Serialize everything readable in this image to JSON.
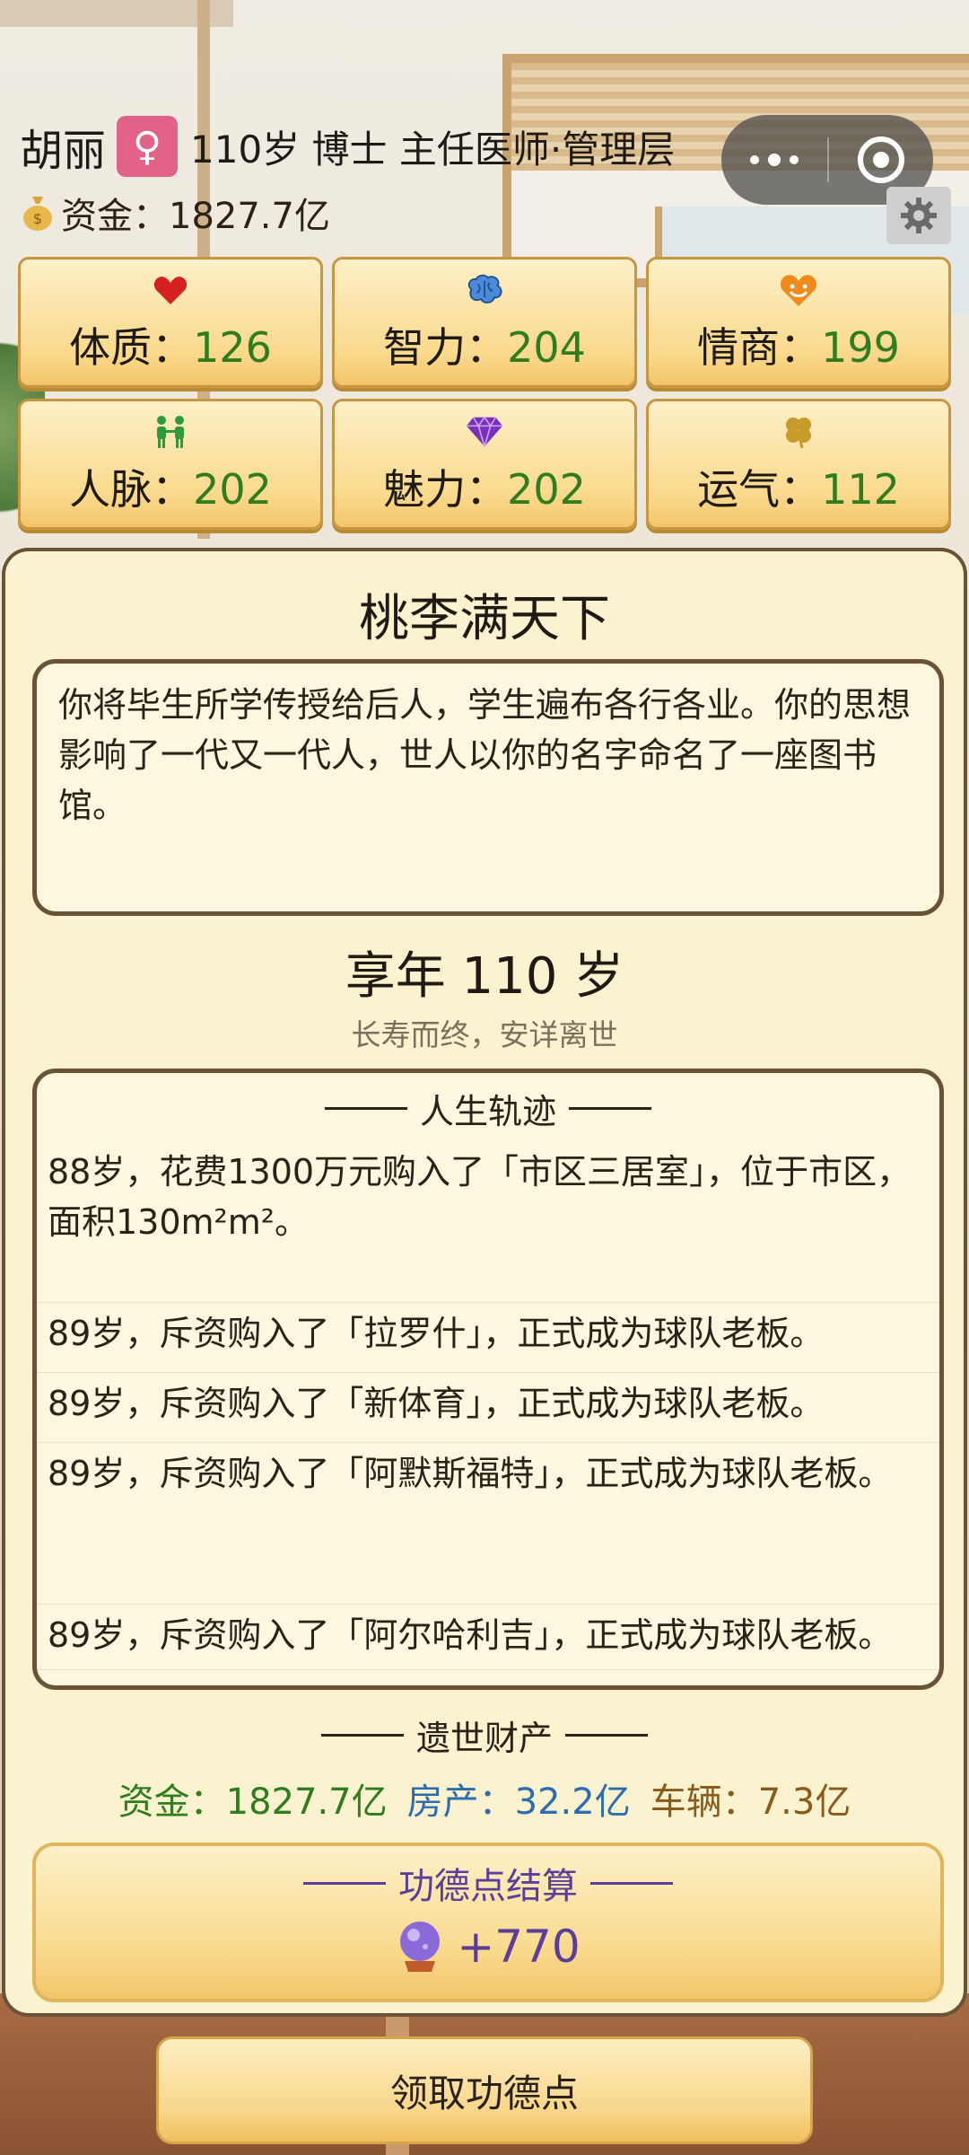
{
  "header": {
    "name": "胡丽",
    "gender_symbol": "♀",
    "info": "110岁 博士 主任医师·管理层",
    "funds": "资金：1827.7亿"
  },
  "stats": [
    {
      "label": "体质：",
      "value": "126",
      "icon": "heart-icon",
      "color": "#d62020"
    },
    {
      "label": "智力：",
      "value": "204",
      "icon": "brain-icon",
      "color": "#3b7fd6"
    },
    {
      "label": "情商：",
      "value": "199",
      "icon": "smile-heart-icon",
      "color": "#f08a1c"
    },
    {
      "label": "人脉：",
      "value": "202",
      "icon": "people-icon",
      "color": "#2f9a3a"
    },
    {
      "label": "魅力：",
      "value": "202",
      "icon": "diamond-icon",
      "color": "#7a2fbf"
    },
    {
      "label": "运气：",
      "value": "112",
      "icon": "clover-icon",
      "color": "#c79a2a"
    }
  ],
  "ending": {
    "title": "桃李满天下",
    "description": "你将毕生所学传授给后人，学生遍布各行各业。你的思想影响了一代又一代人，世人以你的名字命名了一座图书馆。"
  },
  "age": {
    "title": "享年 110 岁",
    "subtitle": "长寿而终，安详离世"
  },
  "timeline": {
    "title": "人生轨迹",
    "entries": [
      "88岁，花费1300万元购入了「市区三居室」，位于市区，面积130m²m²。",
      "89岁，斥资购入了「拉罗什」，正式成为球队老板。",
      "89岁，斥资购入了「新体育」，正式成为球队老板。",
      "89岁，斥资购入了「阿默斯福特」，正式成为球队老板。",
      "89岁，斥资购入了「阿尔哈利吉」，正式成为球队老板。"
    ]
  },
  "legacy": {
    "title": "遗世财产",
    "funds": "资金：1827.7亿",
    "property": "房产：32.2亿",
    "vehicles": "车辆：7.3亿"
  },
  "merit": {
    "title": "功德点结算",
    "value": "+770"
  },
  "claim_button": "领取功德点",
  "colors": {
    "stat_value": "#2f7d1f",
    "panel_bg": "#fbf3cf",
    "border": "#6a5236",
    "merit_purple": "#5b3e9a"
  }
}
